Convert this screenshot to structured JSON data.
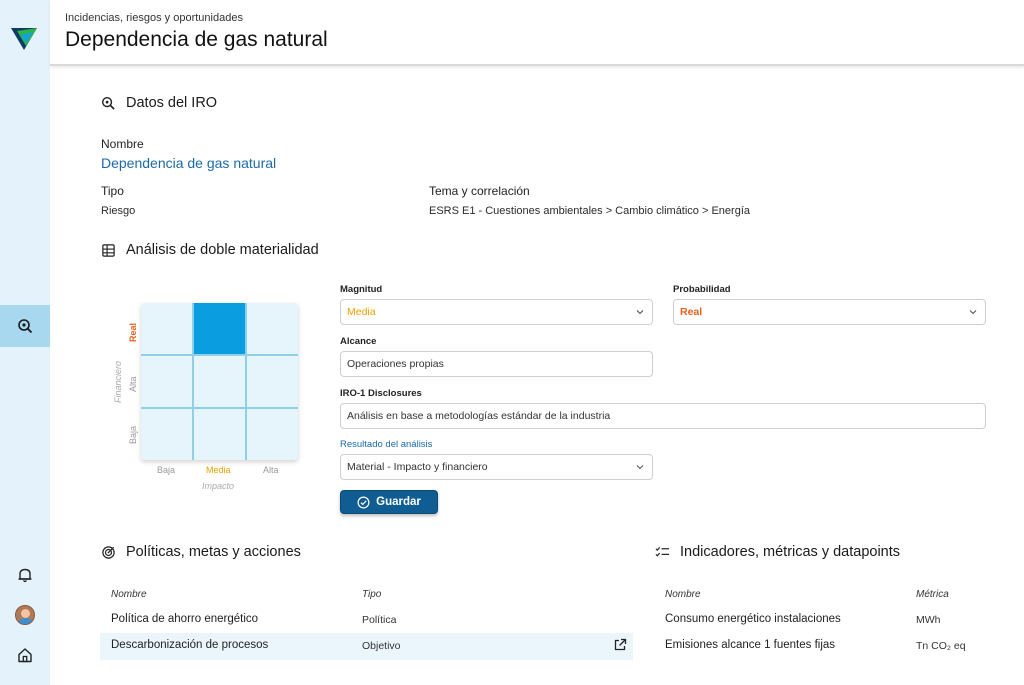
{
  "header": {
    "breadcrumb": "Incidencias, riesgos y oportunidades",
    "title": "Dependencia de gas natural"
  },
  "datos": {
    "section_title": "Datos del IRO",
    "nombre_label": "Nombre",
    "nombre_value": "Dependencia de gas natural",
    "tipo_label": "Tipo",
    "tipo_value": "Riesgo",
    "tema_label": "Tema y correlación",
    "tema_value": "ESRS E1 - Cuestiones ambientales > Cambio climático > Energía"
  },
  "analisis": {
    "section_title": "Análisis de doble materialidad",
    "matrix": {
      "y_axis_title": "Financiero",
      "y_labels": [
        "Real",
        "Alta",
        "Baja"
      ],
      "x_axis_title": "Impacto",
      "x_labels": [
        "Baja",
        "Media",
        "Alta"
      ],
      "selected": {
        "row": "Real",
        "col": "Media"
      },
      "highlight_color": "#0a9ee0",
      "real_color": "#e86020",
      "media_color": "#f0a000"
    },
    "magnitud_label": "Magnitud",
    "magnitud_value": "Media",
    "probabilidad_label": "Probabilidad",
    "probabilidad_value": "Real",
    "alcance_label": "Alcance",
    "alcance_value": "Operaciones propias",
    "iro_label": "IRO-1 Disclosures",
    "iro_value": "Análisis en base a metodologías estándar de la industria",
    "resultado_label": "Resultado del análisis",
    "resultado_value": "Material - Impacto y financiero",
    "save_label": "Guardar"
  },
  "politicas": {
    "section_title": "Políticas, metas y acciones",
    "col_nombre": "Nombre",
    "col_tipo": "Tipo",
    "rows": [
      {
        "nombre": "Política de ahorro energético",
        "tipo": "Política"
      },
      {
        "nombre": "Descarbonización de procesos",
        "tipo": "Objetivo"
      }
    ]
  },
  "indicadores": {
    "section_title": "Indicadores, métricas y datapoints",
    "col_nombre": "Nombre",
    "col_metrica": "Métrica",
    "rows": [
      {
        "nombre": "Consumo energético instalaciones",
        "metrica": "MWh"
      },
      {
        "nombre": "Emisiones alcance 1 fuentes fijas",
        "metrica": "Tn CO₂ eq"
      }
    ]
  },
  "icons": [
    "logo",
    "search-icon",
    "bell-icon",
    "avatar",
    "home-icon",
    "table-icon",
    "target-icon",
    "checklist-icon",
    "external-link-icon",
    "check-circle-icon",
    "chevron-down-icon"
  ]
}
